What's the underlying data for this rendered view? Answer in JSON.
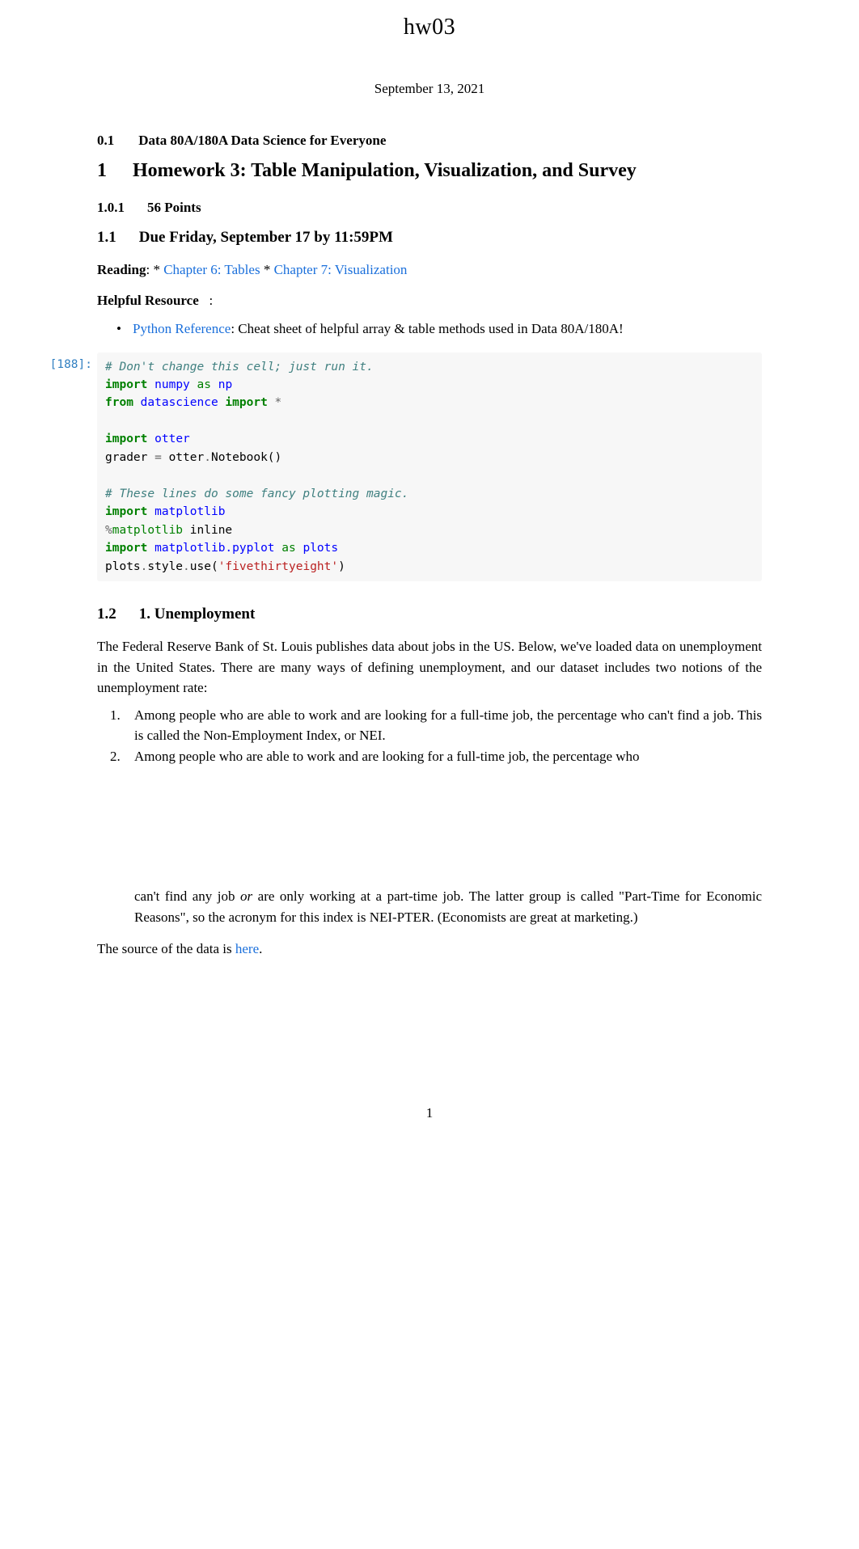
{
  "title": "hw03",
  "date": "September 13, 2021",
  "sec01": {
    "num": "0.1",
    "text": "Data 80A/180A Data Science for Everyone"
  },
  "sec1": {
    "num": "1",
    "text": "Homework 3: Table Manipulation, Visualization, and Survey"
  },
  "sec101": {
    "num": "1.0.1",
    "text": "56 Points"
  },
  "sec11": {
    "num": "1.1",
    "text": "Due Friday, September 17 by 11:59PM"
  },
  "reading": {
    "label": "Reading",
    "sep1": ": * ",
    "link1": "Chapter 6: Tables",
    "sep2": " * ",
    "link2": "Chapter 7: Visualization"
  },
  "helpful": {
    "label": "Helpful Resource",
    "colon": ":"
  },
  "bullet": {
    "link": "Python Reference",
    "text": ": Cheat sheet of helpful array & table methods used in Data 80A/180A!"
  },
  "prompt": "[188]:",
  "code": {
    "c1": "# Don't change this cell; just run it.",
    "l2_import": "import",
    "l2_numpy": "numpy",
    "l2_as": "as",
    "l2_np": "np",
    "l3_from": "from",
    "l3_ds": "datascience",
    "l3_import": "import",
    "l3_star": "*",
    "l5_import": "import",
    "l5_otter": "otter",
    "l6_grader": "grader ",
    "l6_eq": "=",
    "l6_otter": " otter",
    "l6_dot": ".",
    "l6_nb": "Notebook()",
    "c2": "# These lines do some fancy plotting magic.",
    "l9_import": "import",
    "l9_mpl": "matplotlib",
    "l10_pct": "%",
    "l10_mpl": "matplotlib",
    "l10_inline": " inline",
    "l11_import": "import",
    "l11_mpy": "matplotlib.pyplot",
    "l11_as": "as",
    "l11_plots": "plots",
    "l12_plots": "plots",
    "l12_d1": ".",
    "l12_style": "style",
    "l12_d2": ".",
    "l12_use": "use(",
    "l12_str": "'fivethirtyeight'",
    "l12_close": ")"
  },
  "sec12": {
    "num": "1.2",
    "text": "1. Unemployment"
  },
  "para1": "The Federal Reserve Bank of St. Louis publishes data about jobs in the US. Below, we've loaded data on unemployment in the United States. There are many ways of defining unemployment, and our dataset includes two notions of the unemployment rate:",
  "list": {
    "n1": "1.",
    "i1": "Among people who are able to work and are looking for a full-time job, the percentage who can't find a job. This is called the Non-Employment Index, or NEI.",
    "n2": "2.",
    "i2a": "Among people who are able to work and are looking for a full-time job, the percentage who",
    "i2b": "can't find any job ",
    "i2b_or": "or",
    "i2b_rest": " are only working at a part-time job. The latter group is called \"Part-Time for Economic Reasons\", so the acronym for this index is NEI-PTER. (Economists are great at marketing.)"
  },
  "source": {
    "pre": "The source of the data is ",
    "link": "here",
    "post": "."
  },
  "pageNum": "1"
}
